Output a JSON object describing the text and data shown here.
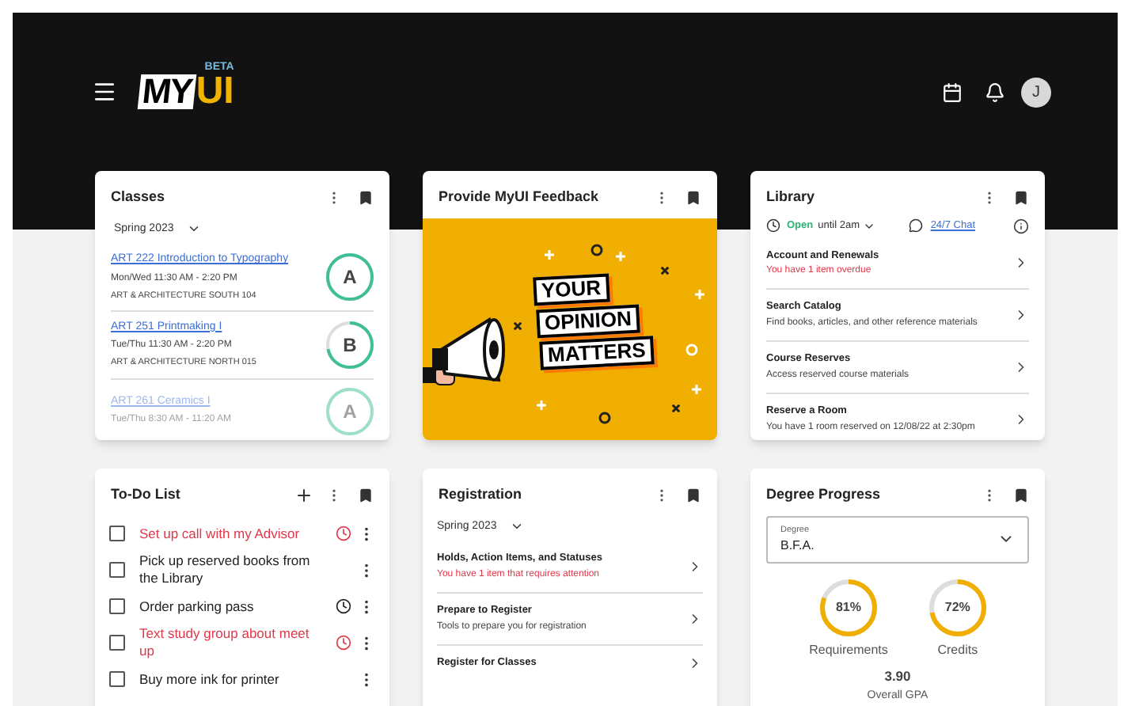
{
  "header": {
    "logo": {
      "my": "MY",
      "ui": "UI",
      "badge": "BETA"
    },
    "avatar": "J"
  },
  "classes": {
    "title": "Classes",
    "term": "Spring 2023",
    "items": [
      {
        "name": "ART 222 Introduction to Typography",
        "time": "Mon/Wed 11:30 AM - 2:20 PM",
        "place": "ART & ARCHITECTURE SOUTH 104",
        "grade": "A",
        "level": 1
      },
      {
        "name": "ART 251 Printmaking I",
        "time": "Tue/Thu 11:30 AM - 2:20 PM",
        "place": "ART & ARCHITECTURE NORTH 015",
        "grade": "B",
        "level": 0.72
      },
      {
        "name": "ART 261 Ceramics I",
        "time": "Tue/Thu 8:30 AM - 11:20 AM",
        "grade": "A",
        "level": 1
      }
    ]
  },
  "feedback": {
    "title": "Provide MyUI Feedback",
    "banner": [
      "YOUR",
      "OPINION",
      "MATTERS"
    ]
  },
  "library": {
    "title": "Library",
    "status": "Open",
    "hours": "until 2am",
    "chat": "24/7 Chat",
    "items": [
      {
        "title": "Account and Renewals",
        "detail": "You have 1 item overdue",
        "alert": true
      },
      {
        "title": "Search Catalog",
        "detail": "Find books, articles, and other reference materials",
        "alert": false
      },
      {
        "title": "Course Reserves",
        "detail": "Access reserved course materials",
        "alert": false
      },
      {
        "title": "Reserve a Room",
        "detail": "You have 1 room reserved on 12/08/22 at 2:30pm",
        "alert": false
      }
    ]
  },
  "todo": {
    "title": "To-Do List",
    "items": [
      {
        "text": "Set up call with my Advisor",
        "checked": false,
        "overdue": true,
        "reminder": true
      },
      {
        "text": "Pick up reserved books from the Library",
        "checked": false,
        "overdue": false,
        "reminder": false
      },
      {
        "text": "Order parking pass",
        "checked": false,
        "overdue": false,
        "reminder": true
      },
      {
        "text": "Text study group about meet up",
        "checked": false,
        "overdue": true,
        "reminder": true
      },
      {
        "text": "Buy more ink for printer",
        "checked": false,
        "overdue": false,
        "reminder": false
      }
    ]
  },
  "registration": {
    "title": "Registration",
    "term": "Spring 2023",
    "items": [
      {
        "title": "Holds, Action Items, and Statuses",
        "detail": "You have 1 item that requires attention",
        "alert": true
      },
      {
        "title": "Prepare to Register",
        "detail": "Tools to prepare you for registration",
        "alert": false
      },
      {
        "title": "Register for Classes"
      }
    ]
  },
  "degree": {
    "title": "Degree Progress",
    "field_label": "Degree",
    "value": "B.F.A.",
    "meters": [
      {
        "reading": "81%",
        "label": "Requirements",
        "level": 0.81
      },
      {
        "reading": "72%",
        "label": "Credits",
        "level": 0.72
      }
    ],
    "gpa": "3.90",
    "gpa_label": "Overall GPA"
  }
}
